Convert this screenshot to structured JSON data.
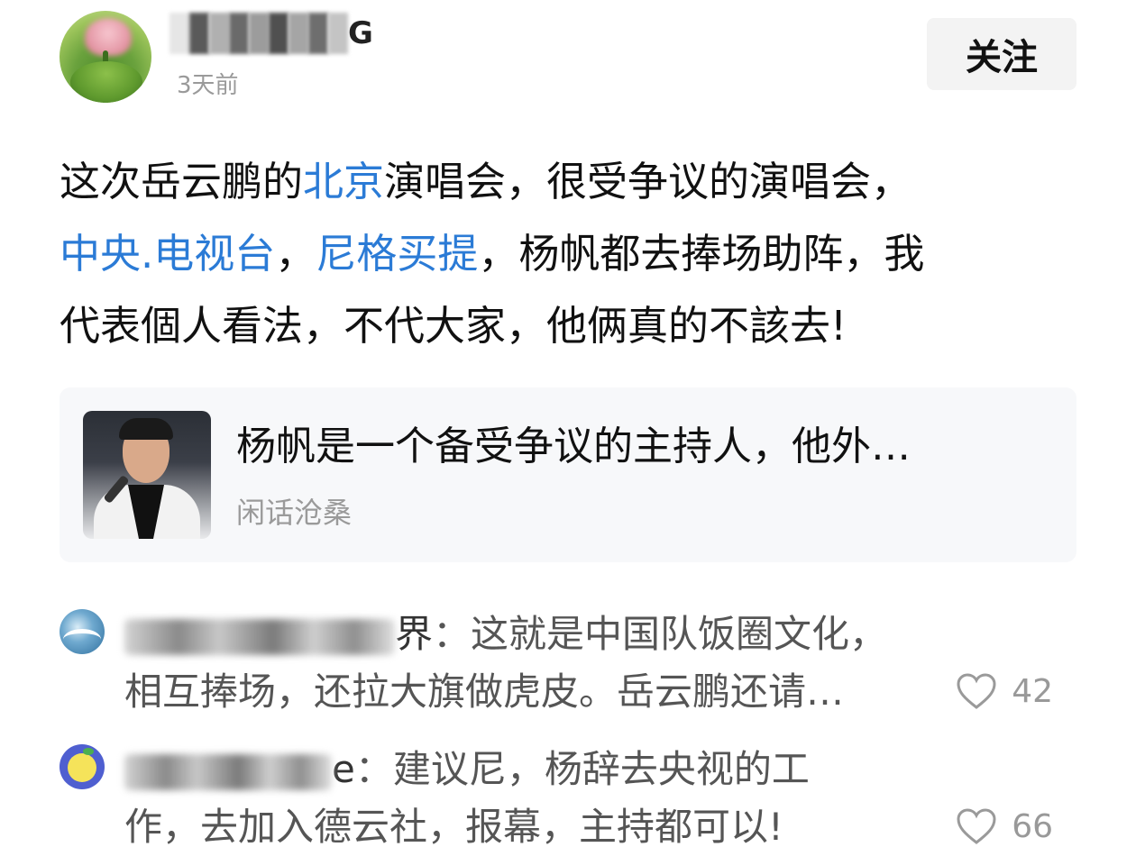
{
  "post": {
    "author": {
      "name_visible_suffix": "G",
      "time": "3天前"
    },
    "follow_label": "关注",
    "text_lines": [
      [
        {
          "text": "这次岳云鹏的",
          "link": false
        },
        {
          "text": "北京",
          "link": true
        },
        {
          "text": "演唱会，很受争议的演唱会，",
          "link": false
        }
      ],
      [
        {
          "text": "中央.电视台",
          "link": true
        },
        {
          "text": "，",
          "link": false
        },
        {
          "text": "尼格买提",
          "link": true
        },
        {
          "text": "，杨帆都去捧场助阵，我",
          "link": false
        }
      ],
      [
        {
          "text": "代表個人看法，不代大家，他俩真的不該去!",
          "link": false
        }
      ]
    ]
  },
  "card": {
    "title": "杨帆是一个备受争议的主持人，他外…",
    "source": "闲话沧桑"
  },
  "comments": [
    {
      "name_suffix": "界",
      "line1": "：这就是中国队饭圈文化，",
      "line2": "相互捧场，还拉大旗做虎皮。岳云鹏还请…",
      "likes": "42"
    },
    {
      "name_suffix": "e",
      "line1": "：建议尼，杨辞去央视的工",
      "line2": "作，去加入德云社，报幕，主持都可以!",
      "likes": "66"
    }
  ],
  "colors": {
    "link": "#2b7bd6",
    "muted": "#9a9a9a",
    "comment_text": "#555555"
  }
}
